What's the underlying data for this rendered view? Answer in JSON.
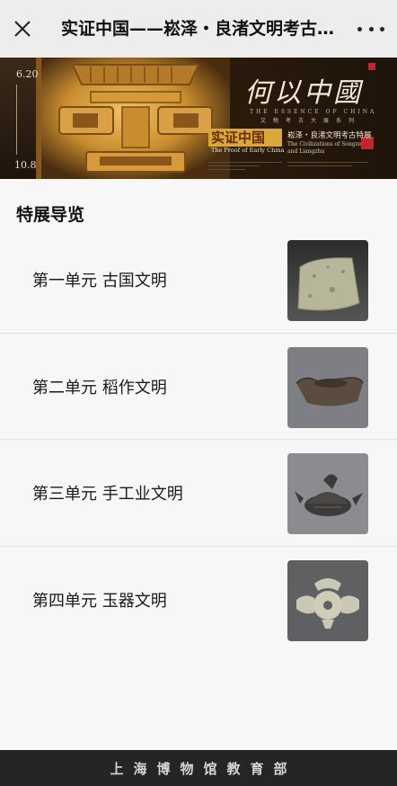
{
  "navbar": {
    "title": "实证中国——崧泽・良渚文明考古特展",
    "close_icon": "close-icon",
    "more_icon": "more-dots-icon"
  },
  "banner": {
    "date_start": "6.20",
    "date_end": "10.8",
    "title_cn": "何以中國",
    "subtitle_en": "THE ESSENCE OF CHINA",
    "subtitle_cn": "文物考古大展系列",
    "proof_cn": "实证中国",
    "proof_en": "The Proof of Early China",
    "exhibition_cn": "崧泽・良渚文明考古特展",
    "exhibition_en_1": "The Civilizations of Songze",
    "exhibition_en_2": "and Liangzhu",
    "colors": {
      "gold": "#e0a846",
      "dark": "#1e140a",
      "seal": "#c0262d"
    }
  },
  "section": {
    "title": "特展导览"
  },
  "units": [
    {
      "label": "第一单元  古国文明",
      "thumb": "stone-axe-image"
    },
    {
      "label": "第二单元  稻作文明",
      "thumb": "pottery-boat-image"
    },
    {
      "label": "第三单元  手工业文明",
      "thumb": "pottery-vessel-image"
    },
    {
      "label": "第四单元  玉器文明",
      "thumb": "jade-ornament-image"
    }
  ],
  "footer": {
    "text": "上海博物馆教育部"
  }
}
